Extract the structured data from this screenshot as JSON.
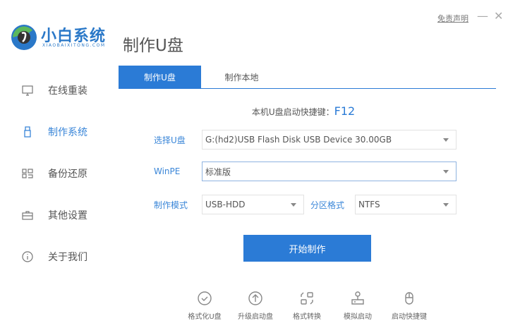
{
  "app": {
    "logo_name": "小白系统",
    "logo_sub": "XIAOBAIXITONG.COM",
    "page_title": "制作U盘",
    "disclaimer": "免责声明",
    "minimize": "—",
    "close": "✕"
  },
  "sidebar": {
    "items": [
      {
        "label": "在线重装",
        "icon": "monitor-icon"
      },
      {
        "label": "制作系统",
        "icon": "usb-icon",
        "active": true
      },
      {
        "label": "备份还原",
        "icon": "grid-icon"
      },
      {
        "label": "其他设置",
        "icon": "briefcase-icon"
      },
      {
        "label": "关于我们",
        "icon": "info-icon"
      }
    ]
  },
  "tabs": [
    {
      "label": "制作U盘",
      "active": true
    },
    {
      "label": "制作本地"
    }
  ],
  "hotkey": {
    "label": "本机U盘启动快捷键：",
    "key": "F12"
  },
  "form": {
    "usb_label": "选择U盘",
    "usb_value": "G:(hd2)USB Flash Disk USB Device 30.00GB",
    "winpe_label": "WinPE",
    "winpe_value": "标准版",
    "mode_label": "制作模式",
    "mode_value": "USB-HDD",
    "partition_label": "分区格式",
    "partition_value": "NTFS"
  },
  "start_button": "开始制作",
  "tools": [
    {
      "label": "格式化U盘",
      "icon": "check-circle-icon"
    },
    {
      "label": "升级启动盘",
      "icon": "upload-circle-icon"
    },
    {
      "label": "格式转换",
      "icon": "convert-icon"
    },
    {
      "label": "模拟启动",
      "icon": "stamp-icon"
    },
    {
      "label": "启动快捷键",
      "icon": "mouse-icon"
    }
  ],
  "colors": {
    "accent": "#2b7bd6"
  }
}
